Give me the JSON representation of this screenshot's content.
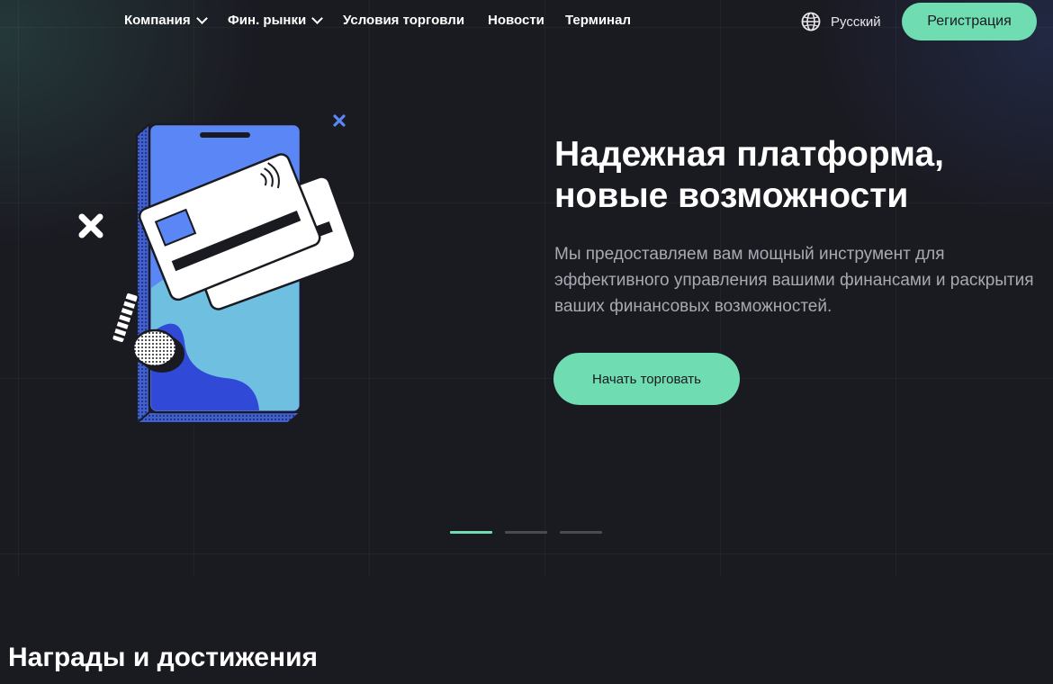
{
  "nav": {
    "items": [
      {
        "label": "Компания",
        "dropdown": true
      },
      {
        "label": "Фин. рынки",
        "dropdown": true
      },
      {
        "label": "Условия торговли",
        "dropdown": false
      },
      {
        "label": "Новости",
        "dropdown": false
      },
      {
        "label": "Терминал",
        "dropdown": false
      }
    ],
    "language": "Русский",
    "language_icon": "globe-icon",
    "register_label": "Регистрация"
  },
  "hero": {
    "title_line1": "Надежная платформа,",
    "title_line2": "новые возможности",
    "description": "Мы предоставляем вам мощный инструмент для эффективного управления вашими финансами и раскрытия ваших финансовых возможностей.",
    "cta_label": "Начать торговать",
    "slides_count": 3,
    "active_slide": 1
  },
  "awards": {
    "title": "Награды и достижения"
  },
  "colors": {
    "accent": "#6fdcb1",
    "background": "#1a1a21",
    "phone_blue": "#5b86f5",
    "text_muted": "#a9a9b2"
  }
}
